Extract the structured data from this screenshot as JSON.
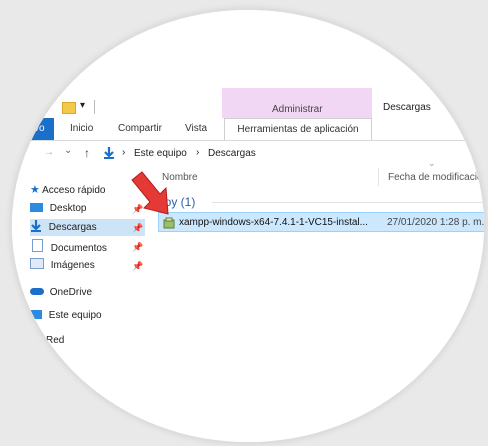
{
  "ribbon": {
    "qa_toolbar_caret": "▾",
    "context_group_label": "Administrar",
    "window_title": "Descargas",
    "file_tab": "vo",
    "tabs": [
      "Inicio",
      "Compartir",
      "Vista"
    ],
    "context_tab": "Herramientas de aplicación"
  },
  "address": {
    "arrow_back": "→",
    "dropdown": "⌄",
    "up": "↑",
    "sep": "›",
    "crumbs": [
      "Este equipo",
      "Descargas"
    ]
  },
  "nav": {
    "quick_access": "Acceso rápido",
    "items": [
      {
        "label": "Desktop",
        "icon": "desktop-icon"
      },
      {
        "label": "Descargas",
        "icon": "downloads-icon"
      },
      {
        "label": "Documentos",
        "icon": "documents-icon"
      },
      {
        "label": "Imágenes",
        "icon": "images-icon"
      }
    ],
    "onedrive": "OneDrive",
    "this_pc": "Este equipo",
    "network": "Red",
    "pin": "📌"
  },
  "list": {
    "col_name": "Nombre",
    "col_date": "Fecha de modificació",
    "col_sort": "⌄",
    "group_label": "hoy (1)",
    "rows": [
      {
        "name": "xampp-windows-x64-7.4.1-1-VC15-instal...",
        "date": "27/01/2020 1:28 p. m."
      }
    ]
  },
  "colors": {
    "accent": "#1a6fc9",
    "selection": "#cce8ff",
    "context_tab": "#f2d7f4",
    "arrow": "#e53935"
  }
}
